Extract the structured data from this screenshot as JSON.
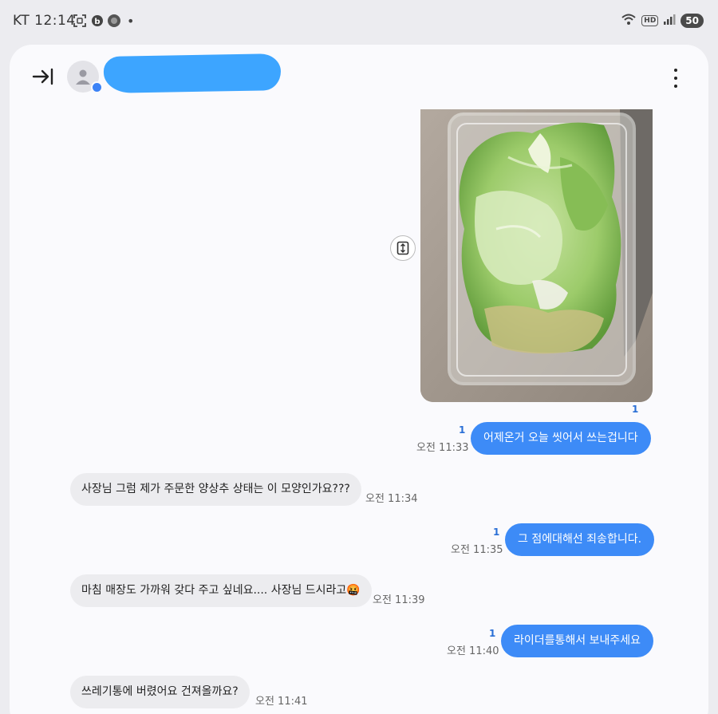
{
  "status_bar": {
    "carrier": "KT",
    "time": "12:14",
    "dot": "•",
    "battery": "50",
    "hd": "HD"
  },
  "header": {
    "contact_name": "",
    "back_icon": "collapse-right-arrow-icon",
    "menu_icon": "more-vertical-icon"
  },
  "messages": [
    {
      "type": "image",
      "direction": "outgoing",
      "description_icon": "photo-lettuce",
      "unread": "1"
    },
    {
      "type": "text",
      "direction": "outgoing",
      "text": "어제온거 오늘 씻어서 쓰는겁니다",
      "unread": "1",
      "time": "오전 11:33"
    },
    {
      "type": "text",
      "direction": "incoming",
      "text": "사장님 그럼 제가 주문한 양상추 상태는 이 모양인가요???",
      "time": "오전 11:34"
    },
    {
      "type": "text",
      "direction": "outgoing",
      "text": "그 점에대해선 죄송합니다.",
      "unread": "1",
      "time": "오전 11:35"
    },
    {
      "type": "text",
      "direction": "incoming",
      "text": "마침 매장도 가까워 갖다 주고 싶네요.... 사장님 드시라고",
      "emoji": "🤬",
      "time": "오전 11:39"
    },
    {
      "type": "text",
      "direction": "outgoing",
      "text": "라이더를통해서 보내주세요",
      "unread": "1",
      "time": "오전 11:40"
    },
    {
      "type": "text",
      "direction": "incoming",
      "text": "쓰레기통에 버렸어요 건져올까요?",
      "time": "오전 11:41"
    }
  ],
  "colors": {
    "outgoing_bubble": "#3d8bf7",
    "incoming_bubble": "#ececef",
    "unread_count": "#2a6fd6",
    "redaction": "#3da5ff"
  }
}
